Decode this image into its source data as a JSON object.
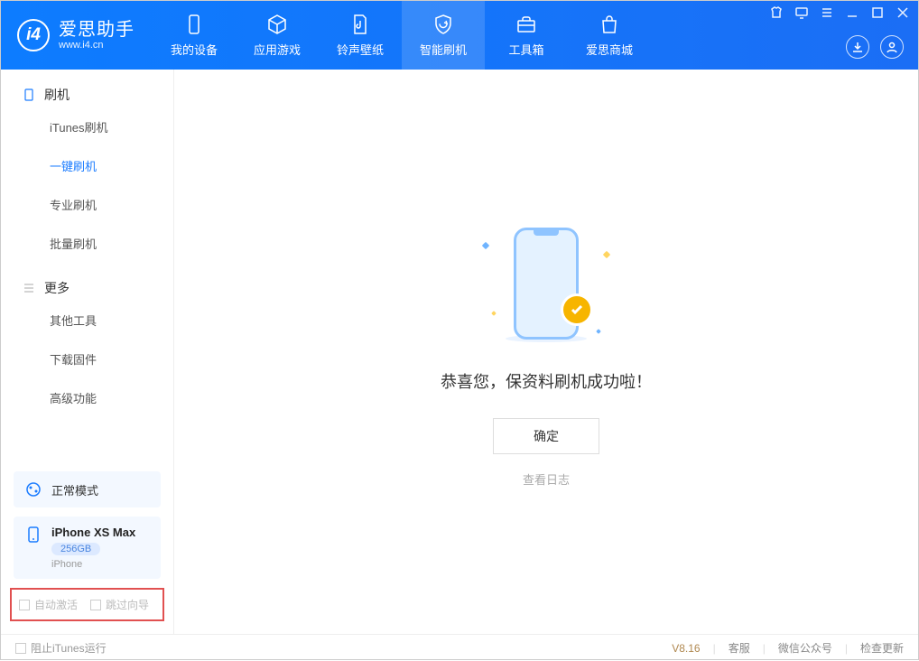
{
  "app": {
    "name": "爱思助手",
    "domain": "www.i4.cn"
  },
  "nav": {
    "tabs": [
      {
        "label": "我的设备",
        "icon": "device"
      },
      {
        "label": "应用游戏",
        "icon": "cube"
      },
      {
        "label": "铃声壁纸",
        "icon": "music"
      },
      {
        "label": "智能刷机",
        "icon": "refresh",
        "active": true
      },
      {
        "label": "工具箱",
        "icon": "toolbox"
      },
      {
        "label": "爱思商城",
        "icon": "bag"
      }
    ]
  },
  "sidebar": {
    "section1": {
      "title": "刷机",
      "items": [
        {
          "label": "iTunes刷机"
        },
        {
          "label": "一键刷机",
          "active": true
        },
        {
          "label": "专业刷机"
        },
        {
          "label": "批量刷机"
        }
      ]
    },
    "section2": {
      "title": "更多",
      "items": [
        {
          "label": "其他工具"
        },
        {
          "label": "下载固件"
        },
        {
          "label": "高级功能"
        }
      ]
    },
    "mode": {
      "label": "正常模式"
    },
    "device": {
      "name": "iPhone XS Max",
      "storage": "256GB",
      "type": "iPhone"
    },
    "checkboxes": {
      "auto_activate": "自动激活",
      "skip_guide": "跳过向导"
    }
  },
  "main": {
    "success_text": "恭喜您，保资料刷机成功啦！",
    "ok_button": "确定",
    "view_log": "查看日志"
  },
  "footer": {
    "block_itunes": "阻止iTunes运行",
    "version": "V8.16",
    "links": {
      "support": "客服",
      "wechat": "微信公众号",
      "update": "检查更新"
    }
  }
}
